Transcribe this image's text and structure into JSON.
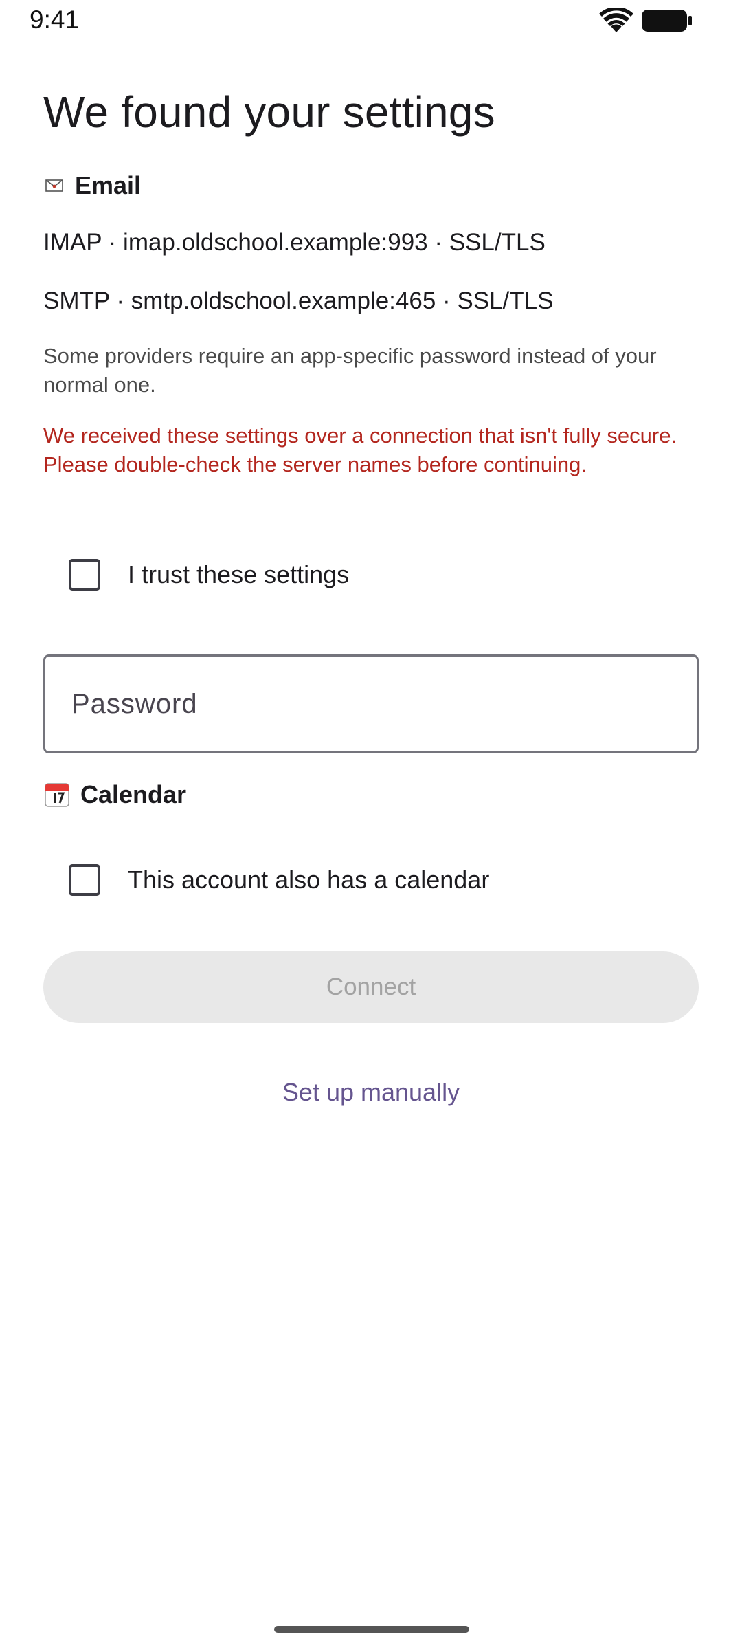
{
  "status_bar": {
    "time": "9:41",
    "wifi_icon": "wifi-icon",
    "battery_icon": "battery-icon"
  },
  "page_title": "We found your settings",
  "email_section": {
    "icon": "envelope-icon",
    "label": "Email",
    "imap_line": "IMAP · imap.oldschool.example:993 · SSL/TLS",
    "smtp_line": "SMTP · smtp.oldschool.example:465 · SSL/TLS",
    "hint": "Some providers require an app-specific password instead of your normal one.",
    "warning": "We received these settings over a connection that isn't fully secure. Please double-check the server names before continuing.",
    "trust_checkbox": {
      "label": "I trust these settings",
      "checked": false
    },
    "password_field": {
      "placeholder": "Password",
      "value": ""
    }
  },
  "calendar_section": {
    "icon": "calendar-icon",
    "label": "Calendar",
    "calendar_checkbox": {
      "label": "This account also has a calendar",
      "checked": false
    }
  },
  "actions": {
    "connect_label": "Connect",
    "connect_enabled": false,
    "manual_setup_label": "Set up manually"
  },
  "colors": {
    "warning": "#b3261e",
    "link": "#65558f",
    "disabled_button_bg": "#e8e8e8",
    "disabled_button_text": "#a3a3a3"
  }
}
